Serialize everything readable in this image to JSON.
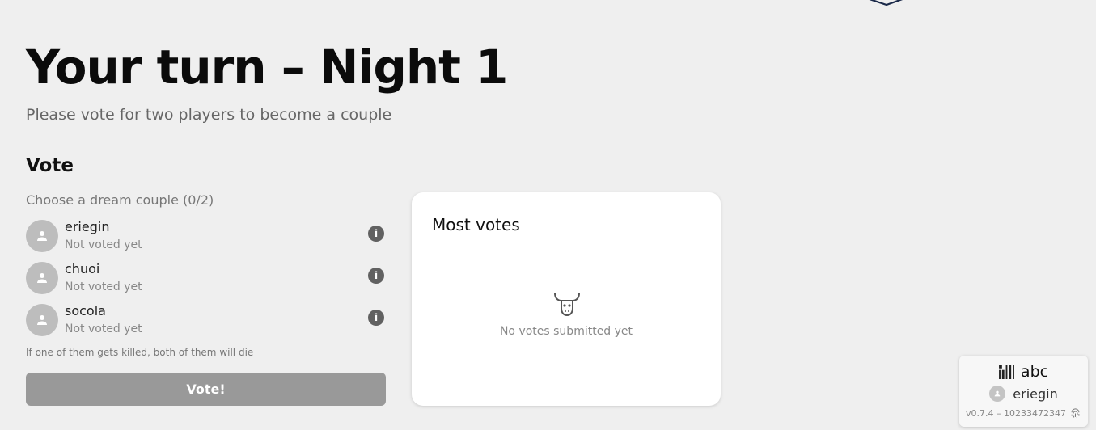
{
  "header": {
    "title": "Your turn – Night 1",
    "subtitle": "Please vote for two players to become a couple"
  },
  "vote_section": {
    "title": "Vote",
    "hint": "Choose a dream couple (0/2)",
    "players": [
      {
        "name": "eriegin",
        "status": "Not voted yet"
      },
      {
        "name": "chuoi",
        "status": "Not voted yet"
      },
      {
        "name": "socola",
        "status": "Not voted yet"
      }
    ],
    "info_icon_glyph": "i",
    "note": "If one of them gets killed, both of them will die",
    "button_label": "Vote!"
  },
  "results": {
    "title": "Most votes",
    "empty_icon": "bull-skull-icon",
    "empty_text": "No votes submitted yet"
  },
  "session": {
    "game_icon": "barcode-icon",
    "game_name": "abc",
    "user_name": "eriegin",
    "version": "v0.7.4 – 10233472347",
    "fingerprint_icon": "fingerprint-icon"
  },
  "colors": {
    "background": "#efefef",
    "avatar": "#bdbdbd",
    "info_icon": "#616161",
    "button_disabled": "#999999",
    "card": "#ffffff"
  }
}
